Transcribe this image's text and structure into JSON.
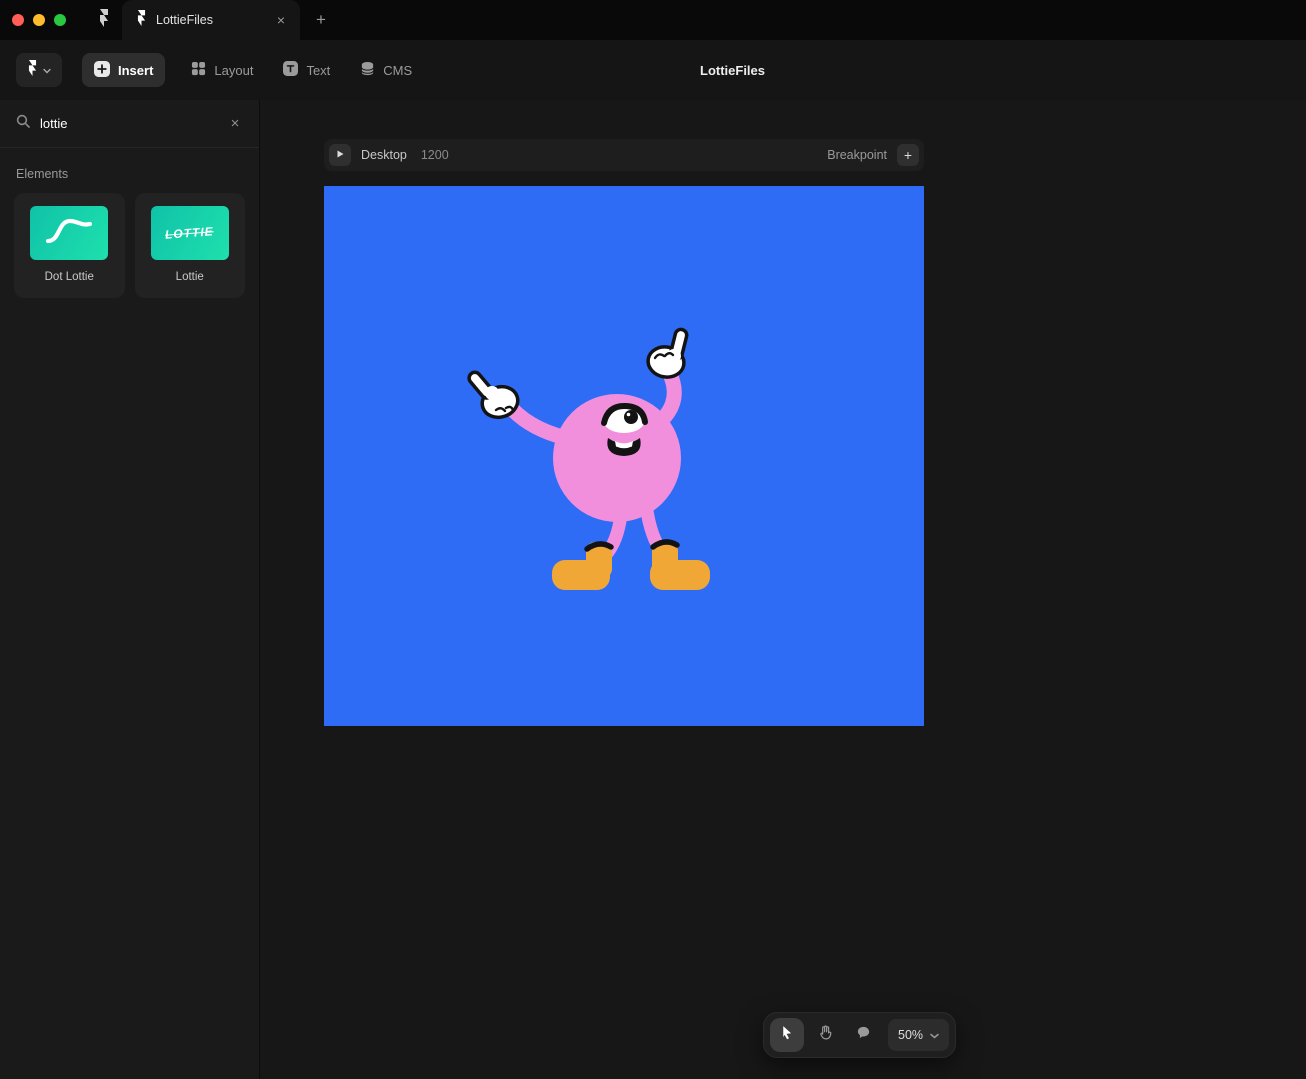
{
  "titlebar": {
    "tab_title": "LottieFiles"
  },
  "icons": {
    "close": "×",
    "plus": "+"
  },
  "toolbar": {
    "insert": "Insert",
    "layout": "Layout",
    "text": "Text",
    "cms": "CMS",
    "project_title": "LottieFiles"
  },
  "sidebar": {
    "search_value": "lottie",
    "section_label": "Elements",
    "elements": [
      {
        "label": "Dot Lottie"
      },
      {
        "label": "Lottie",
        "wordmark": "LOTTIE"
      }
    ]
  },
  "canvas": {
    "breakpoint": {
      "device": "Desktop",
      "width": "1200",
      "add_label": "Breakpoint"
    },
    "artboard_color": "#2e6cf6"
  },
  "view_controls": {
    "zoom": "50%"
  },
  "colors": {
    "element_teal": "#14d2ad",
    "character_pink": "#f18fdc",
    "boots_orange": "#f0a735"
  }
}
